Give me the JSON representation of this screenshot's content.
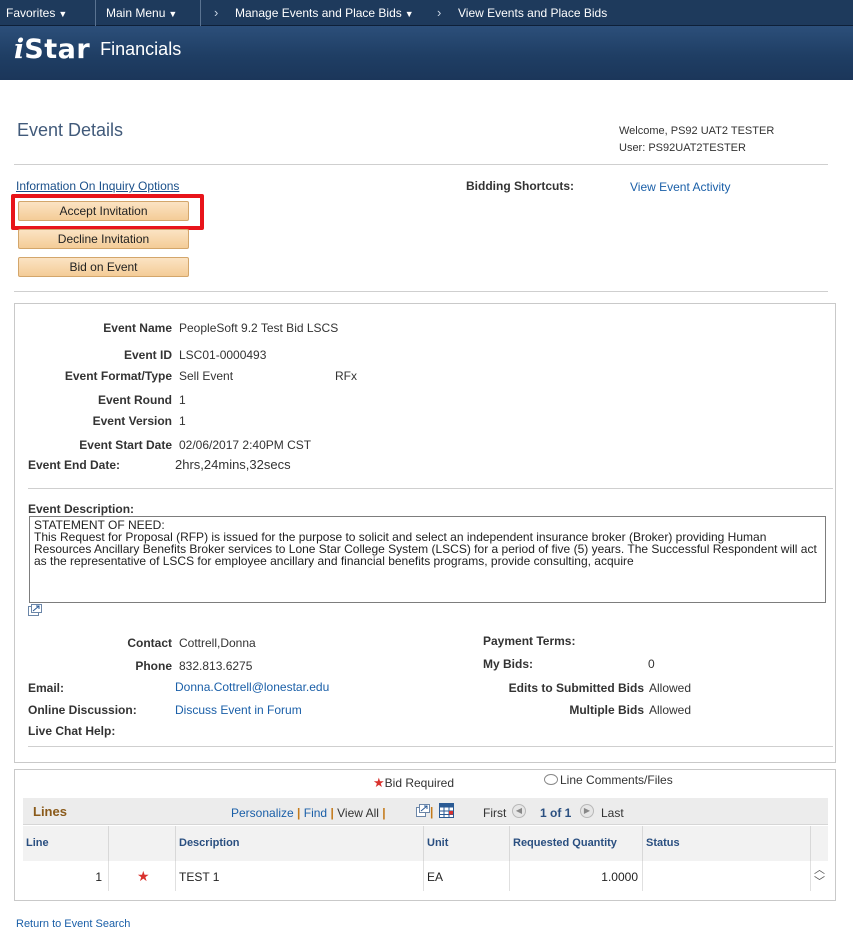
{
  "topnav": {
    "favorites": "Favorites",
    "main_menu": "Main Menu",
    "crumb1": "Manage Events and Place Bids",
    "crumb2": "View Events and Place Bids"
  },
  "banner": {
    "logo_i": "i",
    "logo_star": "Star",
    "logo_financials": "Financials"
  },
  "header": {
    "page_title": "Event Details",
    "welcome": "Welcome, PS92 UAT2 TESTER",
    "user": "User: PS92UAT2TESTER"
  },
  "actions": {
    "info_link": "Information On Inquiry Options",
    "accept": "Accept Invitation",
    "decline": "Decline Invitation",
    "bid": "Bid on Event",
    "bidding_shortcuts": "Bidding Shortcuts:",
    "view_activity": "View Event Activity"
  },
  "event": {
    "name_label": "Event Name",
    "name": "PeopleSoft 9.2 Test Bid LSCS",
    "id_label": "Event ID",
    "id": "LSC01-0000493",
    "format_label": "Event Format/Type",
    "format": "Sell Event",
    "type": "RFx",
    "round_label": "Event Round",
    "round": "1",
    "version_label": "Event Version",
    "version": "1",
    "start_label": "Event Start Date",
    "start": "02/06/2017  2:40PM CST",
    "end_label": "Event End Date:",
    "end": "2hrs,24mins,32secs",
    "desc_label": "Event Description:",
    "desc_heading": "STATEMENT OF NEED:",
    "desc_body": "This Request for Proposal (RFP) is issued for the purpose to solicit and select an independent insurance broker (Broker) providing Human Resources Ancillary Benefits Broker services to Lone Star College System (LSCS) for a period of five (5) years.  The Successful Respondent will act as the representative of LSCS for employee ancillary and financial benefits programs, provide consulting, acquire"
  },
  "contact": {
    "contact_label": "Contact",
    "contact": "Cottrell,Donna",
    "phone_label": "Phone",
    "phone": "832.813.6275",
    "email_label": "Email:",
    "email": "Donna.Cottrell@lonestar.edu",
    "discussion_label": "Online Discussion:",
    "discussion": "Discuss Event in Forum",
    "chat_label": "Live Chat Help:",
    "payment_terms_label": "Payment Terms:",
    "my_bids_label": "My Bids:",
    "my_bids": "0",
    "edits_label": "Edits to Submitted Bids",
    "edits": "Allowed",
    "multiple_label": "Multiple Bids",
    "multiple": "Allowed"
  },
  "legend": {
    "bid_required": "Bid Required",
    "line_comments": "Line Comments/Files"
  },
  "lines": {
    "title": "Lines",
    "personalize": "Personalize",
    "find": "Find",
    "view_all": "View All",
    "first": "First",
    "pager": "1 of 1",
    "last": "Last",
    "columns": [
      "Line",
      "Description",
      "Unit",
      "Requested Quantity",
      "Status"
    ],
    "rows": [
      {
        "line": "1",
        "description": "TEST 1",
        "unit": "EA",
        "qty": "1.0000",
        "status": ""
      }
    ]
  },
  "footer": {
    "return_link": "Return to Event Search"
  },
  "colors": {
    "nav_bg": "#1e3a5c",
    "banner_bg": "#1f3e64",
    "button_bg": "#f4cc97",
    "highlight": "#e8141a",
    "link": "#1a5fa8",
    "title": "#415a7a",
    "star": "#d9322e"
  }
}
